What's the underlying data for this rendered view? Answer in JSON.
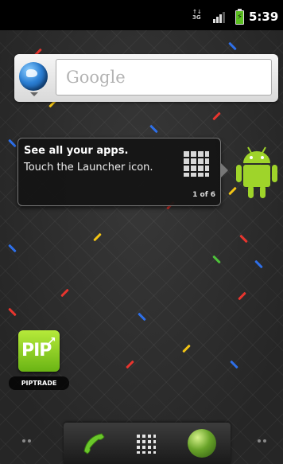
{
  "status_bar": {
    "network_type": "3G",
    "time": "5:39"
  },
  "search_widget": {
    "placeholder": "Google"
  },
  "launcher_hint": {
    "title": "See all your apps.",
    "body": "Touch the Launcher icon.",
    "page_indicator": "1 of 6"
  },
  "desktop": {
    "apps": [
      {
        "label": "PIPTRADE",
        "icon_text": "PIP"
      }
    ]
  },
  "dock": {
    "items": [
      "phone-icon",
      "launcher-icon",
      "browser-icon"
    ]
  },
  "colors": {
    "app_icon": "#8ed221",
    "battery": "#5bbf21",
    "status_bar": "#000000"
  }
}
